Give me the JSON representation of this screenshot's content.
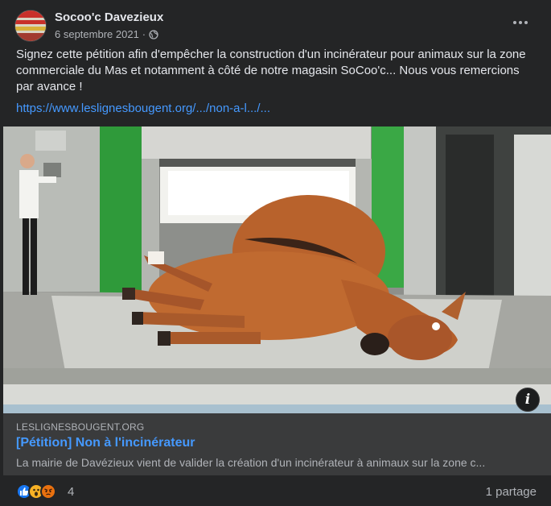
{
  "post": {
    "author": "Socoo'c Davezieux",
    "date": "6 septembre 2021",
    "separator": "·",
    "privacy_icon": "globe-icon",
    "menu_icon": "more-options-icon",
    "text": "Signez cette pétition afin d'empêcher la construction d'un incinérateur pour animaux sur la zone commerciale du Mas et notamment à côté de notre magasin SoCoo'c... Nous vous remercions par avance !",
    "link": "https://www.leslignesbougent.org/.../non-a-l.../..."
  },
  "preview": {
    "domain": "LESLIGNESBOUGENT.ORG",
    "title": "[Pétition] Non à l'incinérateur",
    "description": "La mairie de Davézieux vient de valider la création d'un incinérateur à animaux sur la zone c...",
    "info_icon": "info-icon",
    "info_glyph": "i"
  },
  "footer": {
    "reactions": [
      "like-icon",
      "wow-icon",
      "angry-icon"
    ],
    "reaction_count": "4",
    "shares": "1 partage"
  },
  "colors": {
    "background": "#242526",
    "link": "#4599ff",
    "like": "#1877f2",
    "wow": "#f7b125",
    "angry": "#e9710f"
  }
}
